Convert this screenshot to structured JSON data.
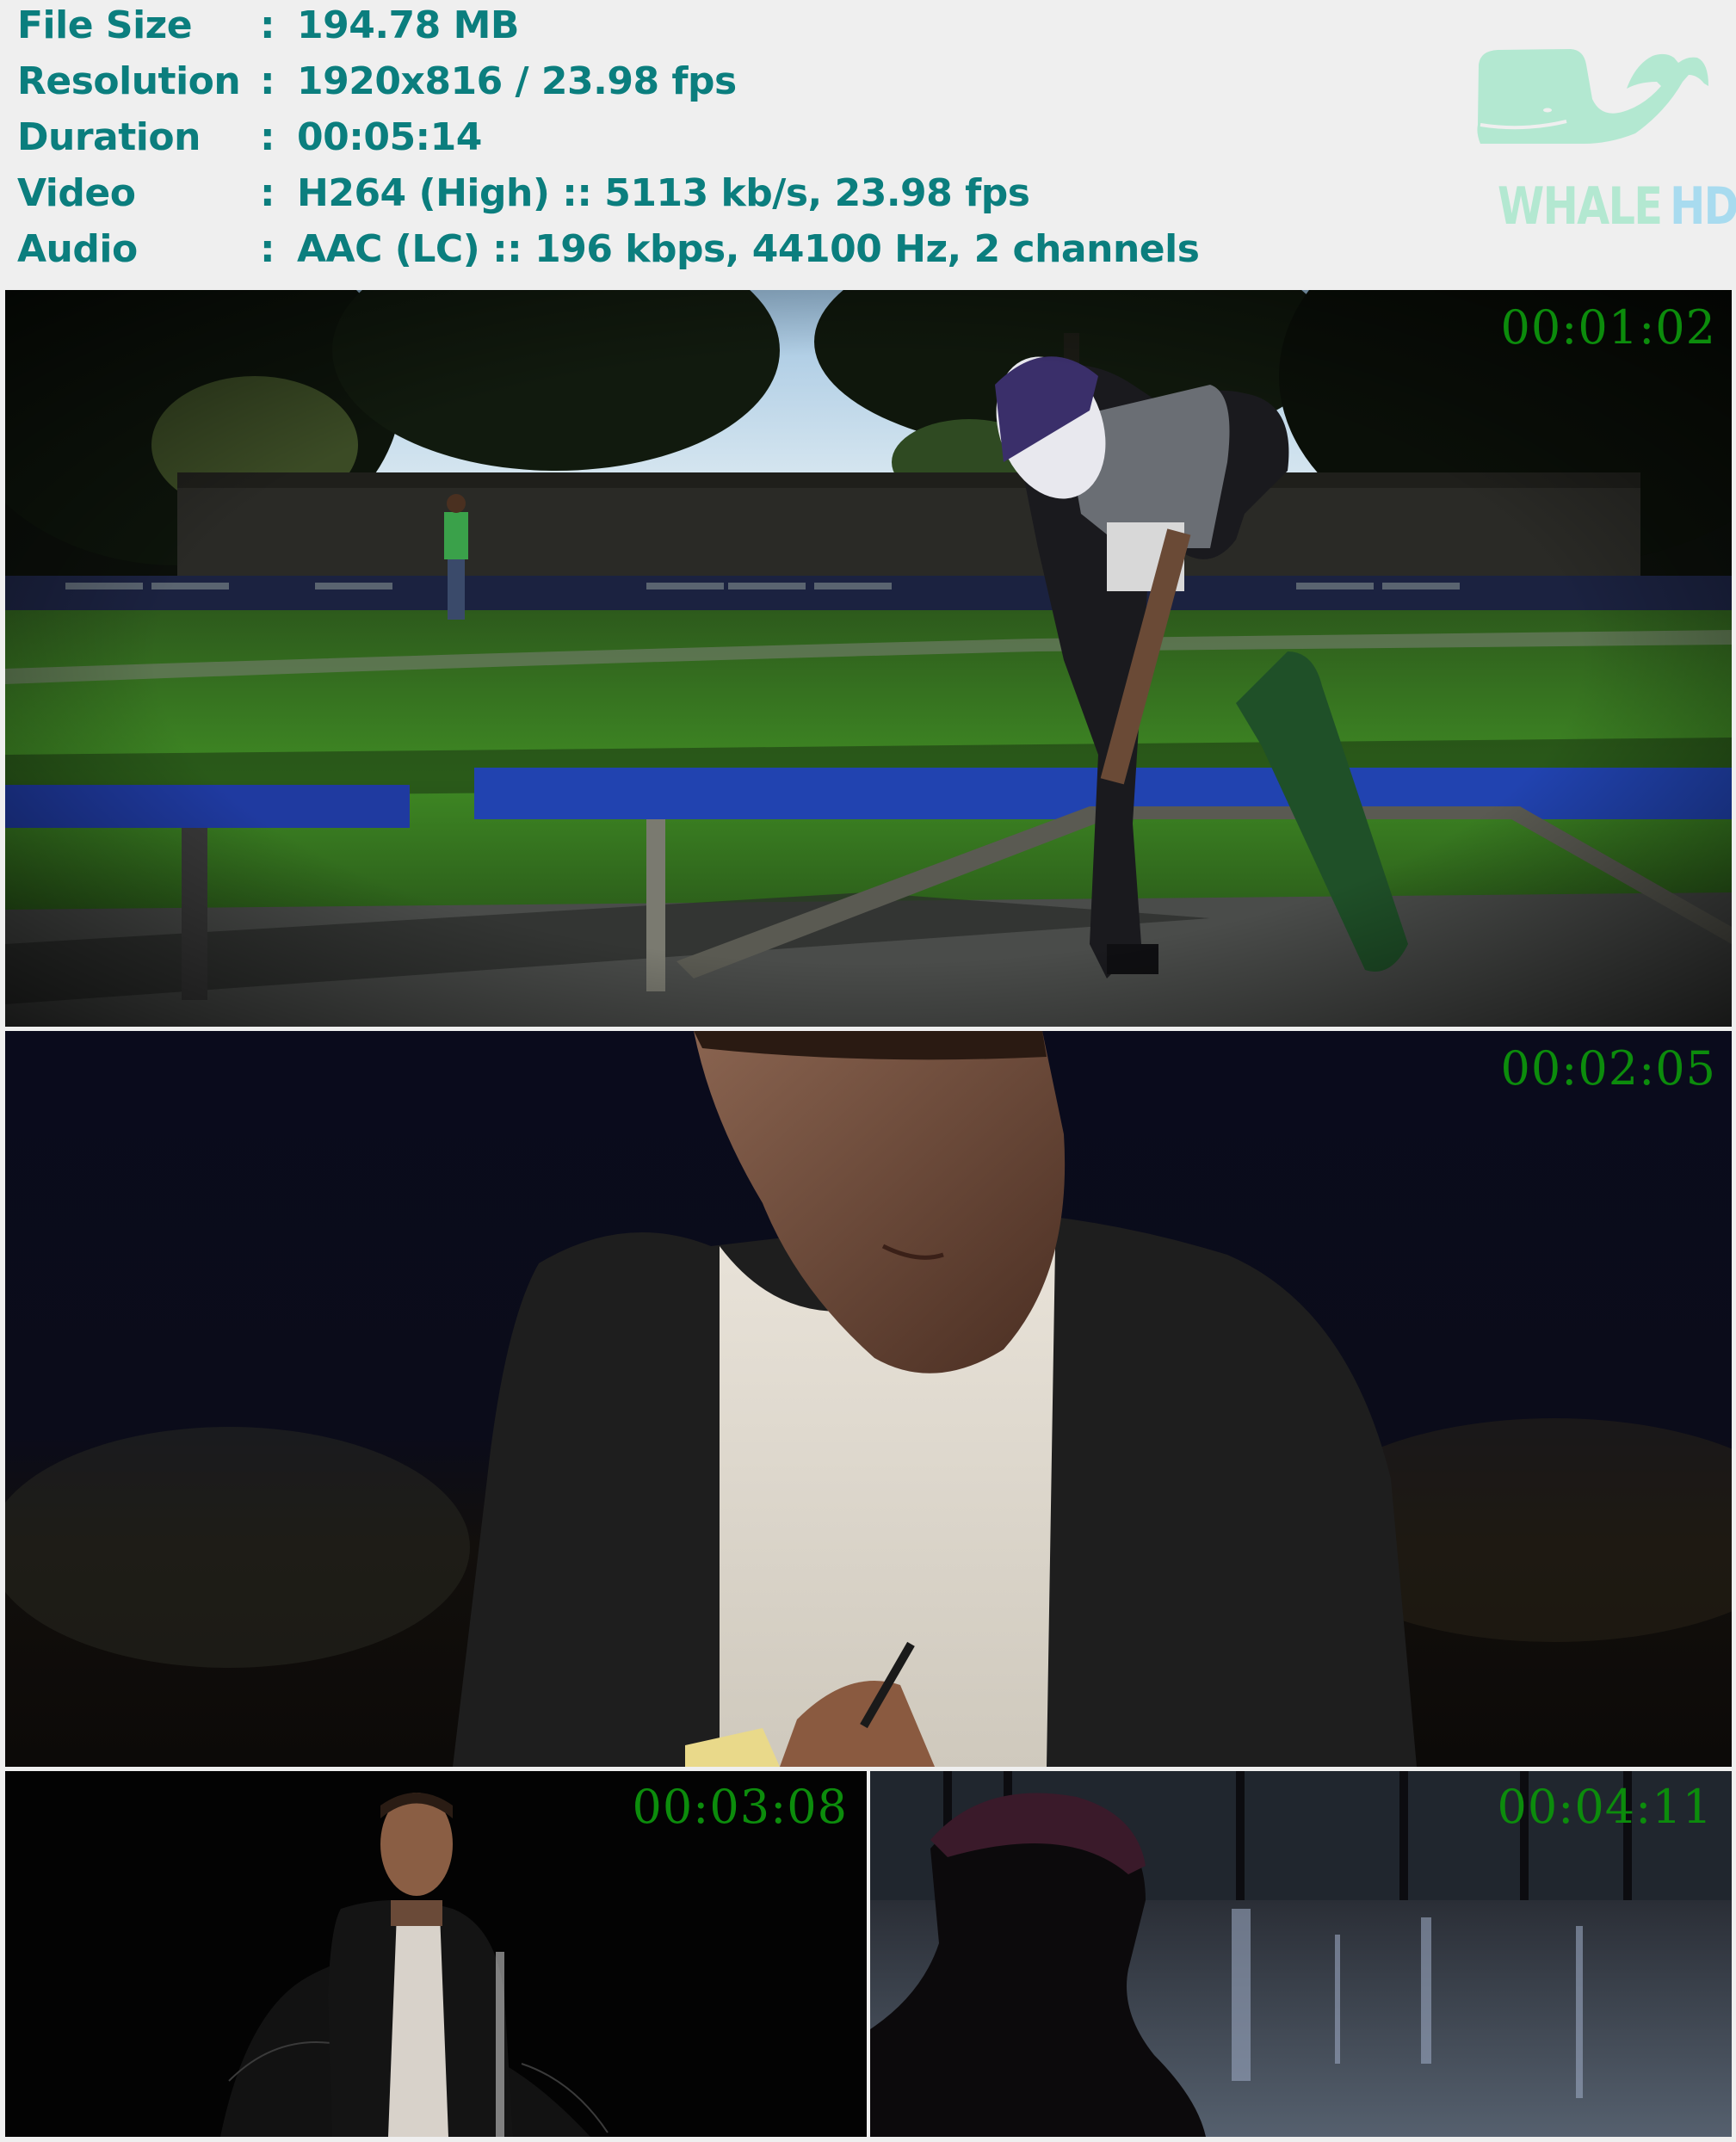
{
  "info": {
    "rows": [
      {
        "label": "File Size",
        "sep": ":",
        "value": "194.78 MB"
      },
      {
        "label": "Resolution",
        "sep": ":",
        "value": "1920x816 / 23.98 fps"
      },
      {
        "label": "Duration",
        "sep": ":",
        "value": "00:05:14"
      },
      {
        "label": "Video",
        "sep": ":",
        "value": "H264 (High) :: 5113 kb/s, 23.98 fps"
      },
      {
        "label": "Audio",
        "sep": ":",
        "value": "AAC (LC) :: 196 kbps, 44100 Hz, 2 channels"
      }
    ]
  },
  "logo": {
    "icon": "whale-icon",
    "text_main": "WHALE",
    "text_accent": "HD",
    "colors": {
      "whale": "#b3e8d1",
      "accent": "#a8dbef"
    }
  },
  "frames": [
    {
      "timestamp": "00:01:02",
      "scene": "park-skateboarder"
    },
    {
      "timestamp": "00:02:05",
      "scene": "man-writing-on-notepad"
    },
    {
      "timestamp": "00:03:08",
      "scene": "man-in-leather-jacket"
    },
    {
      "timestamp": "00:04:11",
      "scene": "boy-in-cap-rain"
    }
  ],
  "colors": {
    "info_text": "#0b7e7e",
    "timestamp": "#0c8c0c",
    "background": "#efefef"
  }
}
